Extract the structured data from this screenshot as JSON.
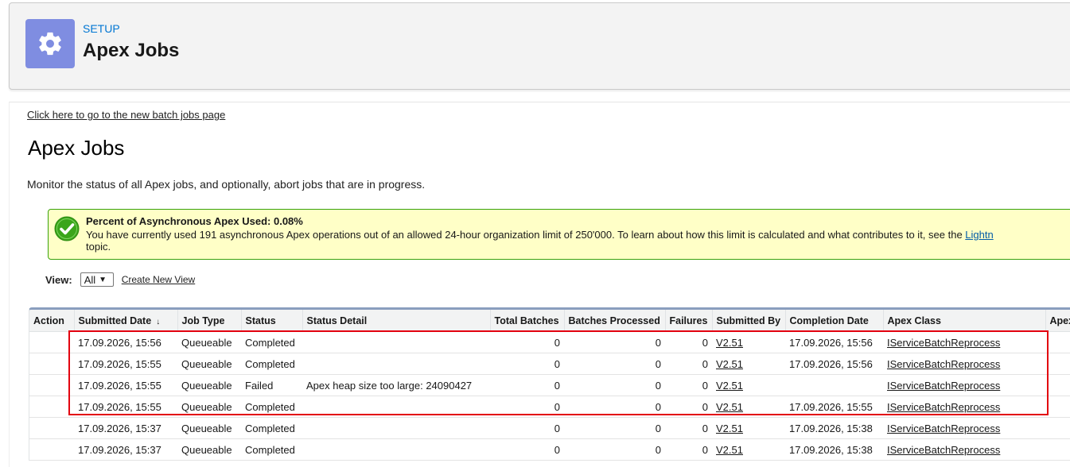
{
  "header": {
    "eyebrow": "SETUP",
    "title": "Apex Jobs"
  },
  "content": {
    "new_batch_link": "Click here to go to the new batch jobs page",
    "title": "Apex Jobs",
    "description": "Monitor the status of all Apex jobs, and optionally, abort jobs that are in progress."
  },
  "info": {
    "heading": "Percent of Asynchronous Apex Used: 0.08%",
    "text_before_link": "You have currently used 191 asynchronous Apex operations out of an allowed 24-hour organization limit of 250'000. To learn about how this limit is calculated and what contributes to it, see the ",
    "link": "Lightn",
    "text_after_link": "topic."
  },
  "view": {
    "label": "View:",
    "selected": "All",
    "create_link": "Create New View"
  },
  "table": {
    "columns": {
      "action": "Action",
      "submitted_date": "Submitted Date",
      "job_type": "Job Type",
      "status": "Status",
      "status_detail": "Status Detail",
      "total_batches": "Total Batches",
      "batches_processed": "Batches Processed",
      "failures": "Failures",
      "submitted_by": "Submitted By",
      "completion_date": "Completion Date",
      "apex_class": "Apex Class",
      "apex_more": "Apex"
    },
    "rows": [
      {
        "submitted": "17.09.2026, 15:56",
        "type": "Queueable",
        "status": "Completed",
        "detail": "",
        "total": "0",
        "processed": "0",
        "failures": "0",
        "by": "V2.51",
        "completed": "17.09.2026, 15:56",
        "class": "IServiceBatchReprocess"
      },
      {
        "submitted": "17.09.2026, 15:55",
        "type": "Queueable",
        "status": "Completed",
        "detail": "",
        "total": "0",
        "processed": "0",
        "failures": "0",
        "by": "V2.51",
        "completed": "17.09.2026, 15:56",
        "class": "IServiceBatchReprocess"
      },
      {
        "submitted": "17.09.2026, 15:55",
        "type": "Queueable",
        "status": "Failed",
        "detail": "Apex heap size too large: 24090427",
        "total": "0",
        "processed": "0",
        "failures": "0",
        "by": "V2.51",
        "completed": "",
        "class": "IServiceBatchReprocess"
      },
      {
        "submitted": "17.09.2026, 15:55",
        "type": "Queueable",
        "status": "Completed",
        "detail": "",
        "total": "0",
        "processed": "0",
        "failures": "0",
        "by": "V2.51",
        "completed": "17.09.2026, 15:55",
        "class": "IServiceBatchReprocess"
      },
      {
        "submitted": "17.09.2026, 15:37",
        "type": "Queueable",
        "status": "Completed",
        "detail": "",
        "total": "0",
        "processed": "0",
        "failures": "0",
        "by": "V2.51",
        "completed": "17.09.2026, 15:38",
        "class": "IServiceBatchReprocess"
      },
      {
        "submitted": "17.09.2026, 15:37",
        "type": "Queueable",
        "status": "Completed",
        "detail": "",
        "total": "0",
        "processed": "0",
        "failures": "0",
        "by": "V2.51",
        "completed": "17.09.2026, 15:38",
        "class": "IServiceBatchReprocess"
      }
    ]
  },
  "colors": {
    "header_icon_bg": "#7f8de1",
    "eyebrow": "#0176d3",
    "info_bg": "#ffffc7",
    "info_border": "#39a20b",
    "highlight": "#e3000f"
  },
  "icons": {
    "header": "gear-icon",
    "info": "check-circle-icon",
    "sort": "arrow-down-icon",
    "select": "chevron-down-icon"
  }
}
